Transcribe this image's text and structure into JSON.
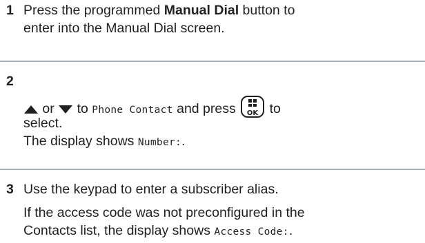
{
  "steps": [
    {
      "number": "1",
      "text_before": "Press the programmed ",
      "bold": "Manual Dial",
      "text_after_line1": " button to",
      "line2": "enter into the Manual Dial screen."
    },
    {
      "number": "2",
      "or_text": " or ",
      "to_text": " to ",
      "menu_item": "Phone Contact",
      "and_press": " and press ",
      "to_after_key": " to",
      "line2": "select.",
      "line3_before": "The display shows ",
      "display_value": "Number:",
      "line3_after": ".",
      "up_icon": "up-arrow-icon",
      "down_icon": "down-arrow-icon",
      "key_icon": "menu-ok-key-icon",
      "key_label": "OK"
    },
    {
      "number": "3",
      "line1": "Use the keypad to enter a subscriber alias.",
      "para2_line1": "If the access code was not preconfigured in the",
      "para2_line2_before": "Contacts list, the display shows ",
      "display_value": "Access Code:",
      "para2_line2_after": "."
    }
  ],
  "colors": {
    "text": "#231f20",
    "divider": "#a7afb7"
  }
}
